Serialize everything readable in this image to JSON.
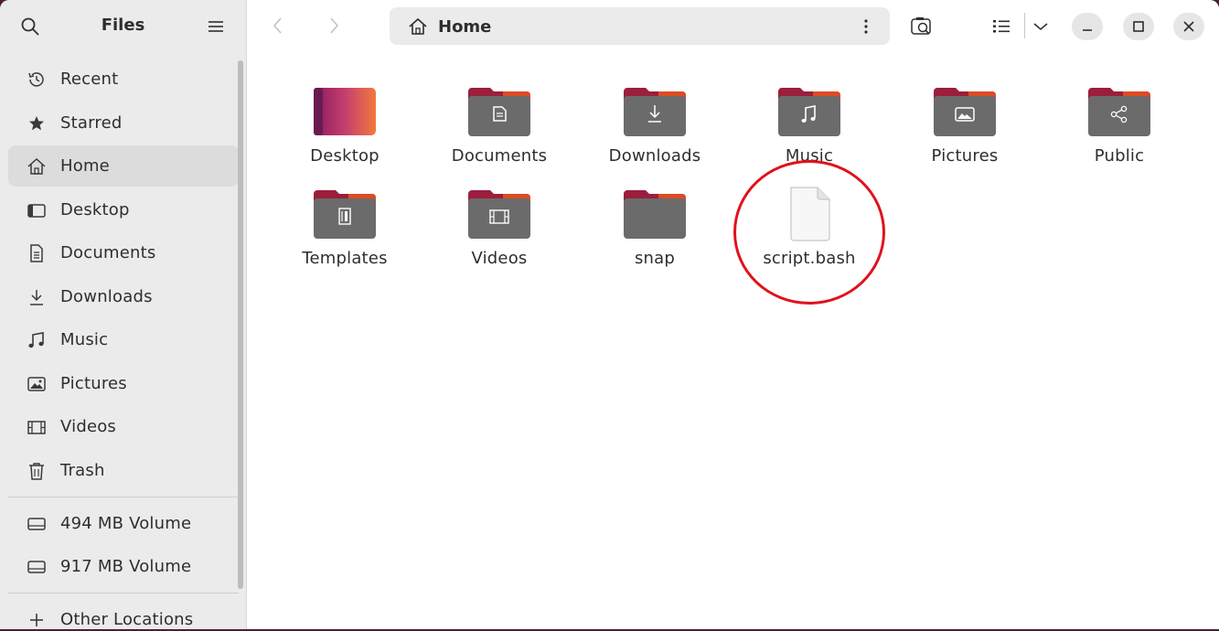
{
  "sidebar": {
    "title": "Files",
    "items": [
      {
        "label": "Recent",
        "icon": "clock-icon"
      },
      {
        "label": "Starred",
        "icon": "star-icon"
      },
      {
        "label": "Home",
        "icon": "home-icon"
      },
      {
        "label": "Desktop",
        "icon": "desktop-icon"
      },
      {
        "label": "Documents",
        "icon": "document-icon"
      },
      {
        "label": "Downloads",
        "icon": "download-icon"
      },
      {
        "label": "Music",
        "icon": "music-icon"
      },
      {
        "label": "Pictures",
        "icon": "picture-icon"
      },
      {
        "label": "Videos",
        "icon": "video-icon"
      },
      {
        "label": "Trash",
        "icon": "trash-icon"
      }
    ],
    "volumes": [
      {
        "label": "494 MB Volume",
        "icon": "drive-icon"
      },
      {
        "label": "917 MB Volume",
        "icon": "drive-icon"
      }
    ],
    "other_locations": "Other Locations"
  },
  "header": {
    "path_label": "Home"
  },
  "content": {
    "items": [
      {
        "name": "Desktop",
        "type": "folder-desktop"
      },
      {
        "name": "Documents",
        "type": "folder",
        "emblem": "document"
      },
      {
        "name": "Downloads",
        "type": "folder",
        "emblem": "download"
      },
      {
        "name": "Music",
        "type": "folder",
        "emblem": "music"
      },
      {
        "name": "Pictures",
        "type": "folder",
        "emblem": "picture"
      },
      {
        "name": "Public",
        "type": "folder",
        "emblem": "share"
      },
      {
        "name": "Templates",
        "type": "folder",
        "emblem": "template"
      },
      {
        "name": "Videos",
        "type": "folder",
        "emblem": "video"
      },
      {
        "name": "snap",
        "type": "folder",
        "emblem": "none"
      },
      {
        "name": "script.bash",
        "type": "file"
      }
    ]
  },
  "colors": {
    "accent": "#e95420",
    "annotation": "#e0121d",
    "folder_body": "#6b6b6b",
    "folder_tab": "#9b1e3d"
  }
}
